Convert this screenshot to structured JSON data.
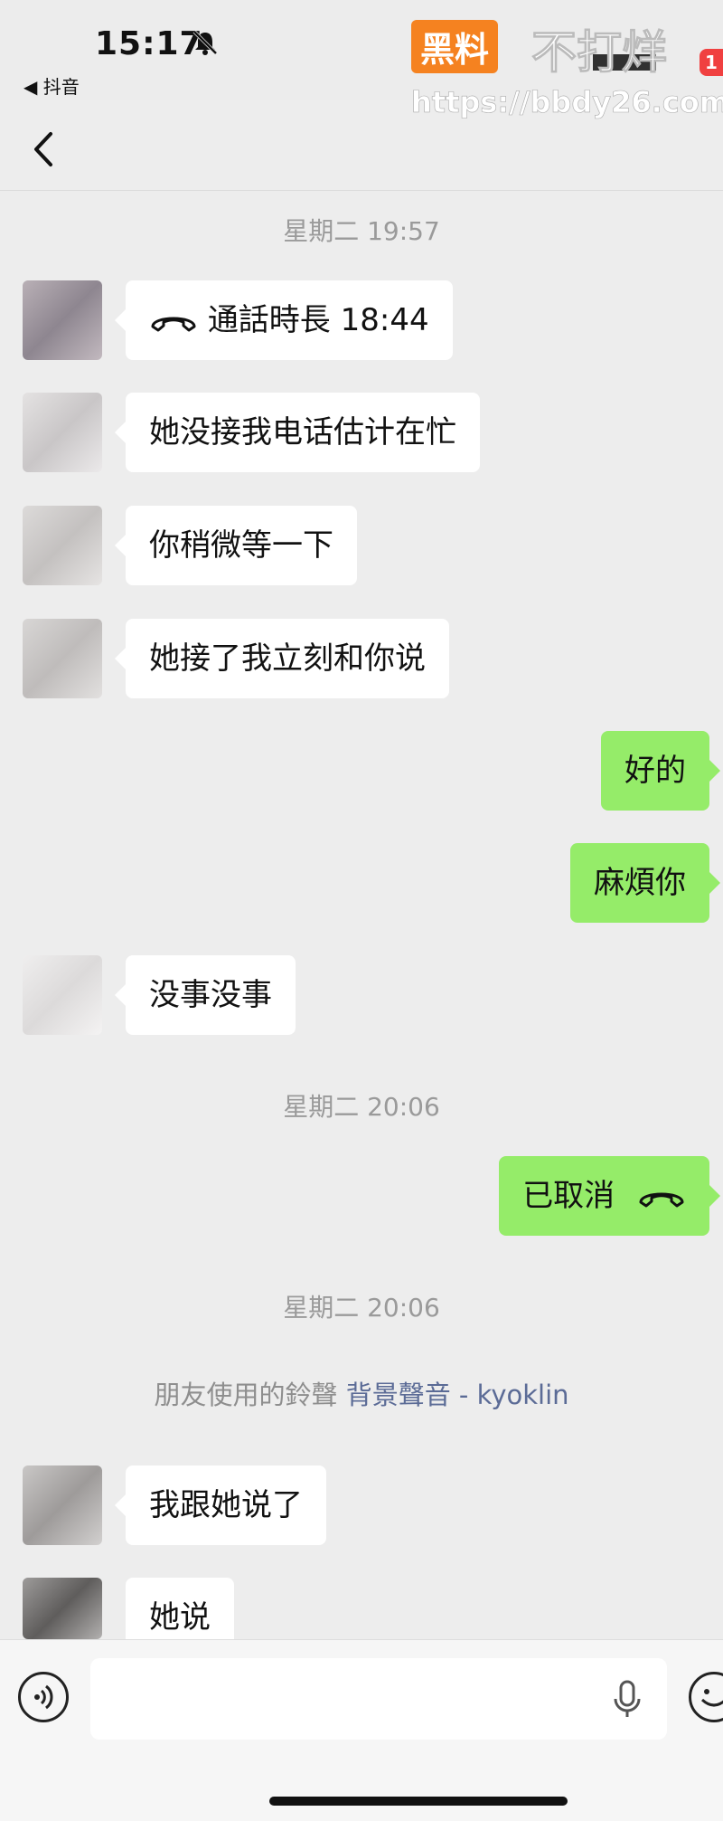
{
  "status_bar": {
    "time": "15:17",
    "back_app": "◀ 抖音",
    "badge_count": "1"
  },
  "watermark": {
    "badge": "黑料",
    "text": "不打烊",
    "url": "https://bbdy26.com"
  },
  "timestamps": [
    "星期二 19:57",
    "星期二 20:06",
    "星期二 20:06"
  ],
  "messages": [
    {
      "side": "in",
      "text": "通話時長 18:44",
      "icon": "phone-hangup-icon"
    },
    {
      "side": "in",
      "text": "她没接我电话估计在忙"
    },
    {
      "side": "in",
      "text": "你稍微等一下"
    },
    {
      "side": "in",
      "text": "她接了我立刻和你说"
    },
    {
      "side": "out",
      "text": "好的"
    },
    {
      "side": "out",
      "text": "麻煩你"
    },
    {
      "side": "in",
      "text": "没事没事"
    },
    {
      "side": "out",
      "text": "已取消",
      "icon": "phone-hangup-icon"
    },
    {
      "side": "in",
      "text": "我跟她说了"
    },
    {
      "side": "in",
      "text": "她说"
    }
  ],
  "ringtone": {
    "prefix": "朋友使用的鈴聲",
    "link": "背景聲音 - kyoklin"
  },
  "input": {
    "placeholder": ""
  },
  "colors": {
    "outgoing_bubble": "#95ec69",
    "incoming_bubble": "#ffffff",
    "background": "#ededed",
    "watermark_orange": "#f58220"
  }
}
